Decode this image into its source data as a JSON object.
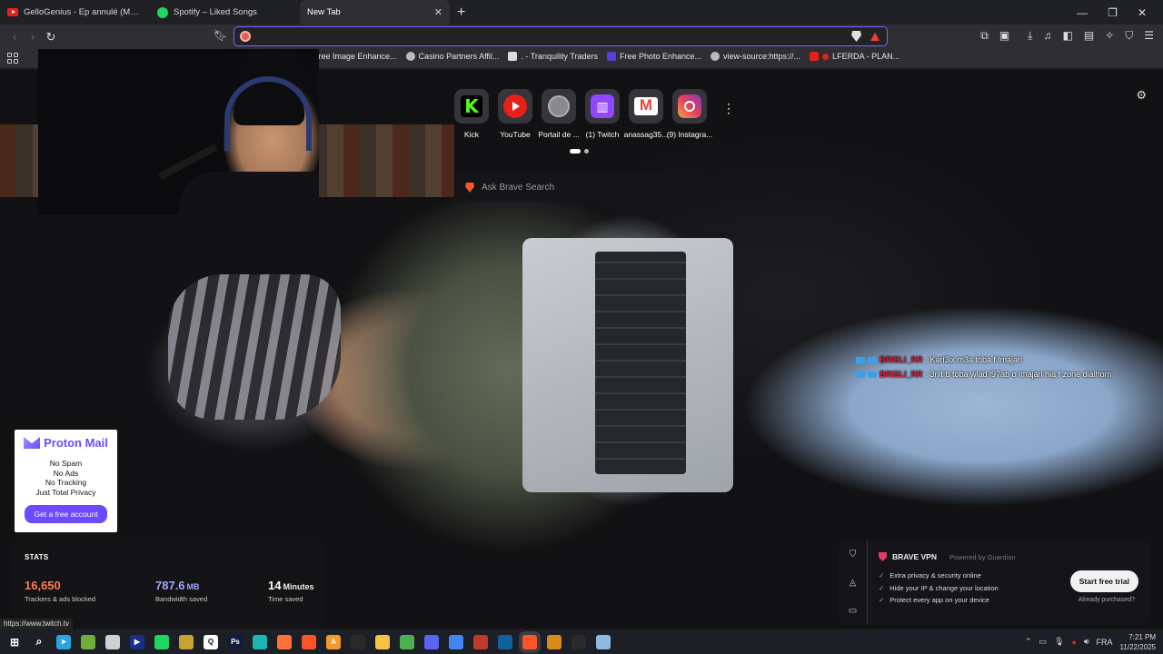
{
  "tabs": [
    {
      "title": "GelloGenius - Ep annulé (Music Vide...",
      "icon": "youtube-icon",
      "active": false
    },
    {
      "title": "Spotify – Liked Songs",
      "icon": "spotify-icon",
      "active": false
    },
    {
      "title": "New Tab",
      "icon": "",
      "active": true
    }
  ],
  "window_controls": {
    "minimize": "—",
    "restore": "❐",
    "close": "✕"
  },
  "toolbar": {
    "omnibox_value": "",
    "back": "‹",
    "forward": "›",
    "reload": "↻"
  },
  "bookmarks": [
    {
      "label": "Free Image Enhance...",
      "icon": "image-icon"
    },
    {
      "label": "Casino Partners Affil...",
      "icon": "globe-icon"
    },
    {
      "label": ". - Tranquility Traders",
      "icon": "page-icon"
    },
    {
      "label": "Free Photo Enhance...",
      "icon": "photo-icon"
    },
    {
      "label": "view-source:https://...",
      "icon": "globe-icon"
    },
    {
      "label": "LFERDA - PLAN...",
      "icon": "youtube-icon"
    }
  ],
  "shortcuts": [
    {
      "label": "Kick",
      "icon": "kick-icon"
    },
    {
      "label": "YouTube",
      "icon": "youtube-icon"
    },
    {
      "label": "Portail de ...",
      "icon": "globe-icon"
    },
    {
      "label": "(1) Twitch",
      "icon": "twitch-icon"
    },
    {
      "label": "anassag35...",
      "icon": "gmail-icon"
    },
    {
      "label": "(9) Instagra...",
      "icon": "instagram-icon"
    }
  ],
  "search": {
    "placeholder": "Ask Brave Search"
  },
  "chat": [
    {
      "user": "BRISLI_RR",
      "message": ": Kari3ix m3a toba f lmajari"
    },
    {
      "user": "BRISLI_RR",
      "message": ": 3nit b toba wlad l97ab o lmajari hia f zone dialhom"
    }
  ],
  "proton_ad": {
    "brand": "Proton Mail",
    "lines": [
      "No Spam",
      "No Ads",
      "No Tracking",
      "Just Total Privacy"
    ],
    "cta": "Get a free account"
  },
  "stats": {
    "title": "STATS",
    "trackers": {
      "value": "16,650",
      "label": "Trackers & ads blocked",
      "color": "#ff7a52"
    },
    "bandwidth": {
      "value": "787.6",
      "unit": "MB",
      "label": "Bandwidth saved",
      "color": "#a2a6ff"
    },
    "time": {
      "value": "14",
      "unit": "Minutes",
      "label": "Time saved",
      "color": "#ffffff"
    }
  },
  "vpn": {
    "title": "BRAVE VPN",
    "powered": "Powered by Guardian",
    "features": [
      "Extra privacy & security online",
      "Hide your IP & change your location",
      "Protect every app on your device"
    ],
    "cta": "Start free trial",
    "already": "Already purchased?"
  },
  "status_url": "https://www.twitch.tv",
  "taskbar": {
    "apps": [
      {
        "name": "start-icon",
        "color": "#1c1f26",
        "glyph": "⊞"
      },
      {
        "name": "search-icon",
        "color": "#1c1f26",
        "glyph": "⌕"
      },
      {
        "name": "telegram-icon",
        "color": "#2aa3e0",
        "glyph": "➤"
      },
      {
        "name": "app-icon",
        "color": "#6fae3a",
        "glyph": ""
      },
      {
        "name": "app-icon",
        "color": "#d0d0d0",
        "glyph": ""
      },
      {
        "name": "app-icon",
        "color": "#1a2f8a",
        "glyph": "▶"
      },
      {
        "name": "spotify-icon",
        "color": "#1ed760",
        "glyph": ""
      },
      {
        "name": "app-icon",
        "color": "#c9a234",
        "glyph": ""
      },
      {
        "name": "app-icon",
        "color": "#ffffff",
        "glyph": "Q"
      },
      {
        "name": "photoshop-icon",
        "color": "#0f1c3a",
        "glyph": "Ps"
      },
      {
        "name": "app-icon",
        "color": "#1bb6b6",
        "glyph": ""
      },
      {
        "name": "firefox-icon",
        "color": "#ff7139",
        "glyph": ""
      },
      {
        "name": "brave-icon",
        "color": "#fb542b",
        "glyph": ""
      },
      {
        "name": "app-icon",
        "color": "#f39a2c",
        "glyph": "A"
      },
      {
        "name": "obs-icon",
        "color": "#2a2a2a",
        "glyph": ""
      },
      {
        "name": "file-explorer-icon",
        "color": "#f5c242",
        "glyph": ""
      },
      {
        "name": "app-icon",
        "color": "#4caf50",
        "glyph": ""
      },
      {
        "name": "discord-icon",
        "color": "#5865f2",
        "glyph": ""
      },
      {
        "name": "chrome-icon",
        "color": "#4285f4",
        "glyph": ""
      },
      {
        "name": "app-icon",
        "color": "#c0392b",
        "glyph": ""
      },
      {
        "name": "vscode-icon",
        "color": "#0e639c",
        "glyph": ""
      },
      {
        "name": "brave-icon",
        "color": "#fb542b",
        "glyph": ""
      },
      {
        "name": "app-icon",
        "color": "#d98a1f",
        "glyph": ""
      },
      {
        "name": "obs-icon",
        "color": "#2a2a2a",
        "glyph": ""
      },
      {
        "name": "app-icon",
        "color": "#8fb9e0",
        "glyph": ""
      }
    ],
    "language": "FRA",
    "time": "7:21 PM",
    "date": "11/22/2025"
  }
}
